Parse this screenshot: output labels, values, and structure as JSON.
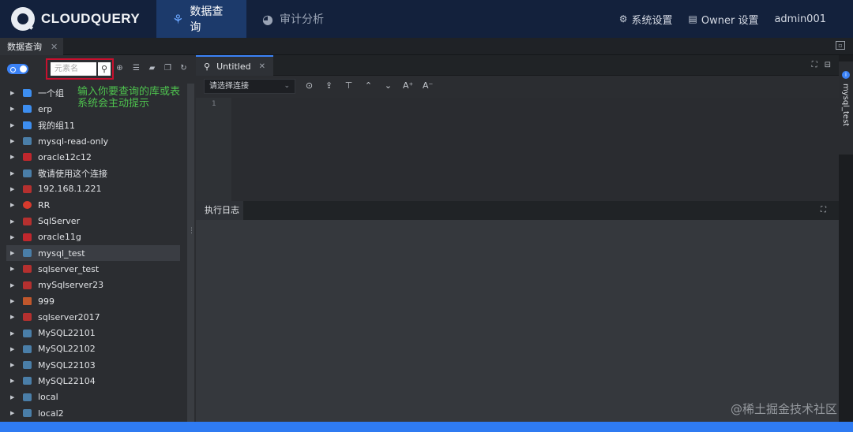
{
  "brand": {
    "name": "CLOUDQUERY"
  },
  "nav": {
    "tabs": [
      {
        "label": "数据查询",
        "icon": "network-icon",
        "active": true
      },
      {
        "label": "审计分析",
        "icon": "pie-chart-icon",
        "active": false
      }
    ],
    "right": {
      "settings": "系统设置",
      "owner": "Owner 设置",
      "user": "admin001"
    }
  },
  "doc_tab": {
    "label": "数据查询"
  },
  "left": {
    "search": {
      "placeholder": "元素名"
    },
    "annotation_line1": "输入你要查询的库或表",
    "annotation_line2": "系统会主动提示",
    "tree": [
      {
        "label": "一个组",
        "icon": "folder"
      },
      {
        "label": "erp",
        "icon": "folder"
      },
      {
        "label": "我的组11",
        "icon": "folder"
      },
      {
        "label": "mysql-read-only",
        "icon": "mysql"
      },
      {
        "label": "oracle12c12",
        "icon": "oracle"
      },
      {
        "label": "敬请使用这个连接",
        "icon": "mysql"
      },
      {
        "label": "192.168.1.221",
        "icon": "sqlserver"
      },
      {
        "label": "RR",
        "icon": "redis"
      },
      {
        "label": "SqlServer",
        "icon": "sqlserver"
      },
      {
        "label": "oracle11g",
        "icon": "oracle"
      },
      {
        "label": "mysql_test",
        "icon": "mysql",
        "selected": true
      },
      {
        "label": "sqlserver_test",
        "icon": "sqlserver"
      },
      {
        "label": "mySqlserver23",
        "icon": "sqlserver"
      },
      {
        "label": "999",
        "icon": "other"
      },
      {
        "label": "sqlserver2017",
        "icon": "sqlserver"
      },
      {
        "label": "MySQL22101",
        "icon": "mysql"
      },
      {
        "label": "MySQL22102",
        "icon": "mysql"
      },
      {
        "label": "MySQL22103",
        "icon": "mysql"
      },
      {
        "label": "MySQL22104",
        "icon": "mysql"
      },
      {
        "label": "local",
        "icon": "mysql"
      },
      {
        "label": "local2",
        "icon": "mysql"
      }
    ]
  },
  "editor": {
    "tab_label": "Untitled",
    "connection_placeholder": "请选择连接",
    "line_number": "1"
  },
  "log": {
    "tab_label": "执行日志"
  },
  "right_rail": {
    "label": "mysql_test"
  },
  "watermark": "@稀土掘金技术社区",
  "colors": {
    "accent": "#3b82f6",
    "nav_bg": "#13213c",
    "highlight_box": "#c8102e",
    "annotation": "#4ec24e"
  }
}
